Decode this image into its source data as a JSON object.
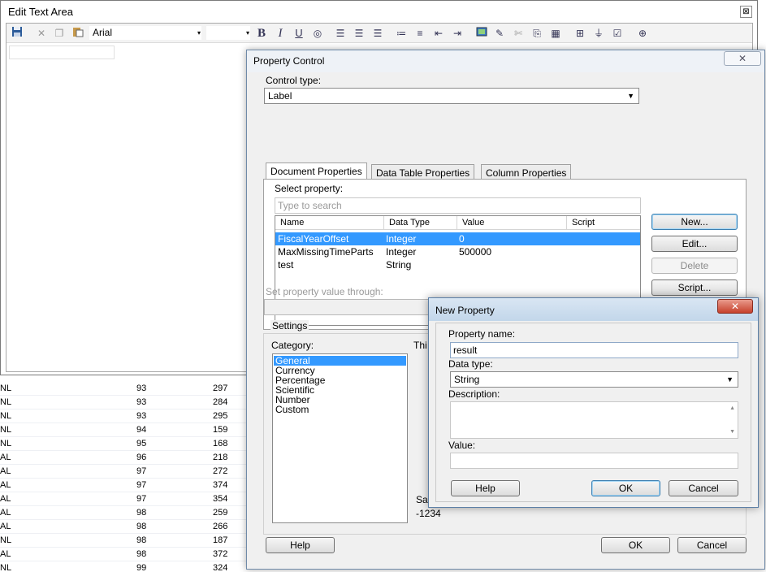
{
  "background_table": {
    "rows": [
      {
        "c1": "NL",
        "c2": "93",
        "c3": "297"
      },
      {
        "c1": "NL",
        "c2": "93",
        "c3": "284"
      },
      {
        "c1": "NL",
        "c2": "93",
        "c3": "295"
      },
      {
        "c1": "NL",
        "c2": "94",
        "c3": "159"
      },
      {
        "c1": "NL",
        "c2": "95",
        "c3": "168"
      },
      {
        "c1": "AL",
        "c2": "96",
        "c3": "218"
      },
      {
        "c1": "AL",
        "c2": "97",
        "c3": "272"
      },
      {
        "c1": "AL",
        "c2": "97",
        "c3": "374"
      },
      {
        "c1": "AL",
        "c2": "97",
        "c3": "354"
      },
      {
        "c1": "AL",
        "c2": "98",
        "c3": "259"
      },
      {
        "c1": "AL",
        "c2": "98",
        "c3": "266"
      },
      {
        "c1": "NL",
        "c2": "98",
        "c3": "187"
      },
      {
        "c1": "AL",
        "c2": "98",
        "c3": "372"
      },
      {
        "c1": "NL",
        "c2": "99",
        "c3": "324"
      }
    ]
  },
  "edit_text_area": {
    "title": "Edit Text Area",
    "close_glyph": "⊠",
    "toolbar": {
      "font": "Arial",
      "bold": "B",
      "italic": "I",
      "underline": "U"
    }
  },
  "property_control": {
    "title": "Property Control",
    "close_glyph": "✕",
    "control_type_label": "Control type:",
    "control_type_value": "Label",
    "tabs": [
      "Document Properties",
      "Data Table Properties",
      "Column Properties"
    ],
    "select_property_label": "Select property:",
    "search_placeholder": "Type to search",
    "columns": [
      "Name",
      "Data Type",
      "Value",
      "Script"
    ],
    "rows": [
      {
        "name": "FiscalYearOffset",
        "type": "Integer",
        "value": "0",
        "script": ""
      },
      {
        "name": "MaxMissingTimeParts",
        "type": "Integer",
        "value": "500000",
        "script": ""
      },
      {
        "name": "test",
        "type": "String",
        "value": "",
        "script": ""
      }
    ],
    "buttons": {
      "new": "New...",
      "edit": "Edit...",
      "delete": "Delete",
      "script": "Script...",
      "help": "Help",
      "ok": "OK",
      "cancel": "Cancel"
    },
    "set_value_label": "Set property value through:",
    "settings_label": "Settings",
    "category_label": "Category:",
    "categories": [
      "General",
      "Currency",
      "Percentage",
      "Scientific",
      "Number",
      "Custom"
    ],
    "partial_label": "Thi",
    "sample_label": "Sa",
    "sample_value": "-1234"
  },
  "new_property": {
    "title": "New Property",
    "close_glyph": "✕",
    "name_label": "Property name:",
    "name_value": "result",
    "type_label": "Data type:",
    "type_value": "String",
    "description_label": "Description:",
    "value_label": "Value:",
    "buttons": {
      "help": "Help",
      "ok": "OK",
      "cancel": "Cancel"
    }
  }
}
